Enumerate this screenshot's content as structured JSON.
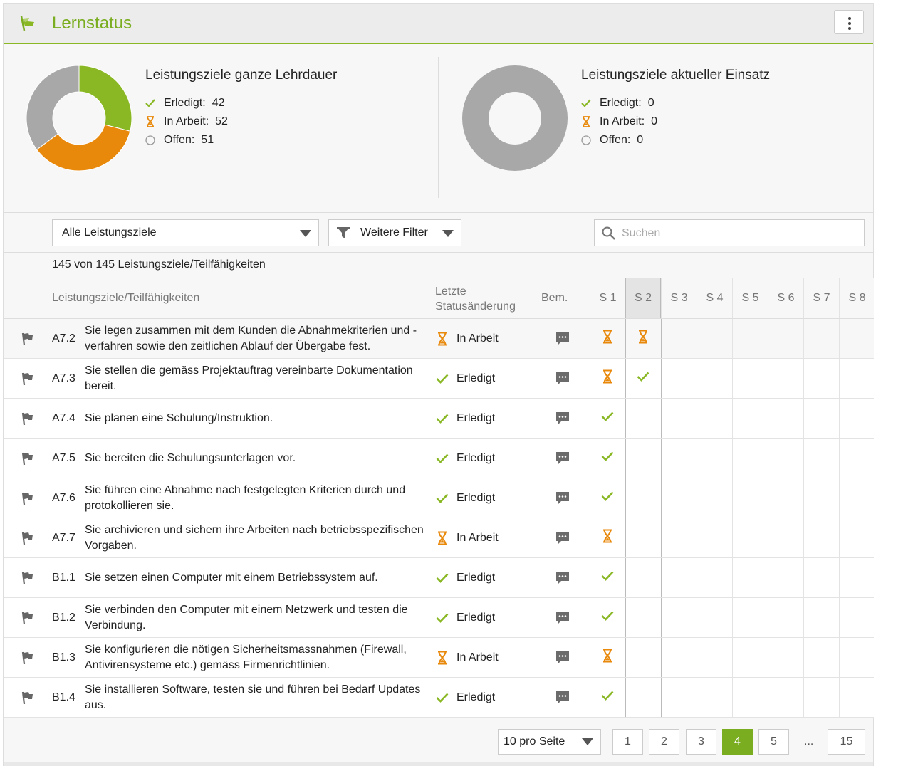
{
  "header": {
    "title": "Lernstatus"
  },
  "stats": {
    "total": {
      "title": "Leistungsziele ganze Lehrdauer",
      "items": [
        {
          "label": "Erledigt:",
          "value": "42"
        },
        {
          "label": "In Arbeit:",
          "value": "52"
        },
        {
          "label": "Offen:",
          "value": "51"
        }
      ]
    },
    "current": {
      "title": "Leistungsziele aktueller Einsatz",
      "items": [
        {
          "label": "Erledigt:",
          "value": "0"
        },
        {
          "label": "In Arbeit:",
          "value": "0"
        },
        {
          "label": "Offen:",
          "value": "0"
        }
      ]
    },
    "colors": {
      "done": "#8ab825",
      "progress": "#e8890c",
      "open": "#a8a8a8"
    }
  },
  "filters": {
    "scope_value": "Alle Leistungsziele",
    "more_filters_label": "Weitere Filter",
    "search_placeholder": "Suchen"
  },
  "count_text": "145 von 145 Leistungsziele/Teilfähigkeiten",
  "table": {
    "headers": {
      "goal": "Leistungsziele/Teilfähigkeiten",
      "status_line1": "Letzte",
      "status_line2": "Statusänderung",
      "remarks": "Bem.",
      "semesters": [
        "S 1",
        "S 2",
        "S 3",
        "S 4",
        "S 5",
        "S 6",
        "S 7",
        "S 8"
      ]
    },
    "rows": [
      {
        "code": "A7.2",
        "text": "Sie legen zusammen mit dem Kunden die Abnahmekriterien und -verfahren sowie den zeitlichen Ablauf der Übergabe fest.",
        "status": "In Arbeit",
        "status_kind": "progress",
        "sem": [
          "progress",
          "progress",
          "",
          "",
          "",
          "",
          "",
          ""
        ]
      },
      {
        "code": "A7.3",
        "text": "Sie stellen die gemäss Projektauftrag vereinbarte Dokumentation bereit.",
        "status": "Erledigt",
        "status_kind": "done",
        "sem": [
          "progress",
          "done",
          "",
          "",
          "",
          "",
          "",
          ""
        ]
      },
      {
        "code": "A7.4",
        "text": "Sie planen eine Schulung/Instruktion.",
        "status": "Erledigt",
        "status_kind": "done",
        "sem": [
          "done",
          "",
          "",
          "",
          "",
          "",
          "",
          ""
        ]
      },
      {
        "code": "A7.5",
        "text": "Sie bereiten die Schulungsunterlagen vor.",
        "status": "Erledigt",
        "status_kind": "done",
        "sem": [
          "done",
          "",
          "",
          "",
          "",
          "",
          "",
          ""
        ]
      },
      {
        "code": "A7.6",
        "text": "Sie führen eine Abnahme nach festgelegten Kriterien durch und protokollieren sie.",
        "status": "Erledigt",
        "status_kind": "done",
        "sem": [
          "done",
          "",
          "",
          "",
          "",
          "",
          "",
          ""
        ]
      },
      {
        "code": "A7.7",
        "text": "Sie archivieren und sichern ihre Arbeiten nach betriebsspezifischen Vorgaben.",
        "status": "In Arbeit",
        "status_kind": "progress",
        "sem": [
          "progress",
          "",
          "",
          "",
          "",
          "",
          "",
          ""
        ]
      },
      {
        "code": "B1.1",
        "text": "Sie setzen einen Computer mit einem Betriebssystem auf.",
        "status": "Erledigt",
        "status_kind": "done",
        "sem": [
          "done",
          "",
          "",
          "",
          "",
          "",
          "",
          ""
        ]
      },
      {
        "code": "B1.2",
        "text": "Sie verbinden den Computer mit einem Netzwerk und testen die Verbindung.",
        "status": "Erledigt",
        "status_kind": "done",
        "sem": [
          "done",
          "",
          "",
          "",
          "",
          "",
          "",
          ""
        ]
      },
      {
        "code": "B1.3",
        "text": "Sie konfigurieren die nötigen Sicherheitsmassnahmen (Firewall, Antivirensysteme etc.) gemäss Firmenrichtlinien.",
        "status": "In Arbeit",
        "status_kind": "progress",
        "sem": [
          "progress",
          "",
          "",
          "",
          "",
          "",
          "",
          ""
        ]
      },
      {
        "code": "B1.4",
        "text": "Sie installieren Software, testen sie und führen bei Bedarf Updates aus.",
        "status": "Erledigt",
        "status_kind": "done",
        "sem": [
          "done",
          "",
          "",
          "",
          "",
          "",
          "",
          ""
        ]
      }
    ]
  },
  "pagination": {
    "page_size": "10 pro Seite",
    "pages": [
      "1",
      "2",
      "3",
      "4",
      "5"
    ],
    "current_page": "4",
    "ellipsis": "...",
    "last_page": "15"
  }
}
